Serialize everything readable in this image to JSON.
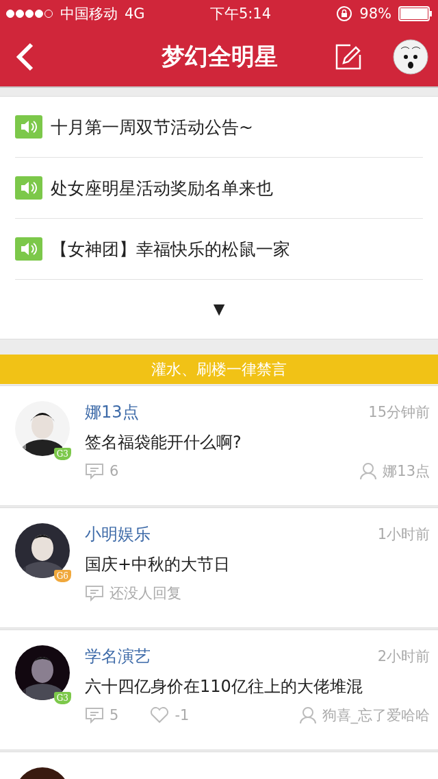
{
  "status_bar": {
    "carrier": "中国移动",
    "network": "4G",
    "time": "下午5:14",
    "battery": "98%"
  },
  "nav": {
    "title": "梦幻全明星"
  },
  "notices": [
    {
      "text": "十月第一周双节活动公告~"
    },
    {
      "text": "处女座明星活动奖励名单来也"
    },
    {
      "text": "【女神团】幸福快乐的松鼠一家"
    }
  ],
  "expand": {
    "label": "▼"
  },
  "banner": {
    "text": "灌水、刷楼一律禁言"
  },
  "posts": [
    {
      "name": "娜13点",
      "time": "15分钟前",
      "title": "签名福袋能开什么啊?",
      "badge": {
        "label": "G3",
        "color": "#7cc84a"
      },
      "replies": "6",
      "author": "娜13点"
    },
    {
      "name": "小明娱乐",
      "time": "1小时前",
      "title": "国庆+中秋的大节日",
      "badge": {
        "label": "G6",
        "color": "#f0a83c"
      },
      "replies": "还没人回复"
    },
    {
      "name": "学名演艺",
      "time": "2小时前",
      "title": "六十四亿身价在110亿往上的大佬堆混",
      "badge": {
        "label": "G3",
        "color": "#7cc84a"
      },
      "replies": "5",
      "likes": "-1",
      "author": "狗喜_忘了爱哈哈"
    }
  ]
}
